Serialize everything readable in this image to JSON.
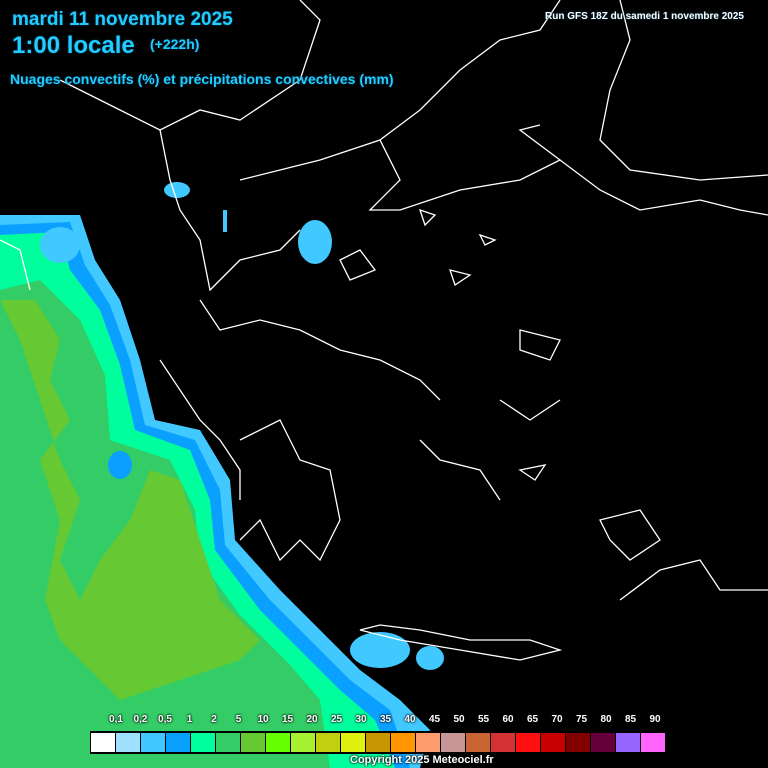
{
  "header": {
    "date": "mardi 11 novembre 2025",
    "time": "1:00 locale",
    "lead": "(+222h)",
    "parameter": "Nuages convectifs (%) et précipitations convectives (mm)",
    "run": "Run GFS 18Z du samedi 1 novembre 2025"
  },
  "legend": {
    "labels": [
      "0,1",
      "0,2",
      "0,5",
      "1",
      "2",
      "5",
      "10",
      "15",
      "20",
      "25",
      "30",
      "35",
      "40",
      "45",
      "50",
      "55",
      "60",
      "65",
      "70",
      "75",
      "80",
      "85",
      "90"
    ],
    "colors": [
      "#ffffff",
      "#a0e0ff",
      "#40c8ff",
      "#0aa0ff",
      "#00ff9c",
      "#33cc66",
      "#66c832",
      "#66ff00",
      "#a8f032",
      "#c0d010",
      "#e0f010",
      "#c89600",
      "#ff9600",
      "#ff9c6e",
      "#c89696",
      "#c86432",
      "#d23232",
      "#ff1010",
      "#c80000",
      "#800000",
      "#64003c",
      "#9664ff",
      "#ff64ff"
    ]
  },
  "copyright": "Copyright 2025 Meteociel.fr"
}
